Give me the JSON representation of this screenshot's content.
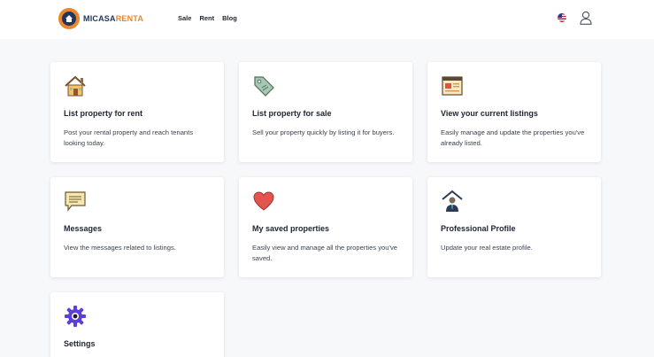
{
  "brand": {
    "part1": "MICASA",
    "part2": "RENTA"
  },
  "nav": {
    "sale": "Sale",
    "rent": "Rent",
    "blog": "Blog"
  },
  "header": {
    "flag_icon": "us-flag-icon",
    "account_icon": "user-icon"
  },
  "cards": [
    {
      "icon": "house-icon",
      "title": "List property for rent",
      "desc": "Post your rental property and reach tenants looking today."
    },
    {
      "icon": "price-tag-icon",
      "title": "List property for sale",
      "desc": "Sell your property quickly by listing it for buyers."
    },
    {
      "icon": "listing-browser-icon",
      "title": "View your current listings",
      "desc": "Easily manage and update the properties you've already listed."
    },
    {
      "icon": "message-icon",
      "title": "Messages",
      "desc": "View the messages related to listings."
    },
    {
      "icon": "heart-icon",
      "title": "My saved properties",
      "desc": "Easily view and manage all the properties you've saved."
    },
    {
      "icon": "agent-profile-icon",
      "title": "Professional Profile",
      "desc": "Update your real estate profile."
    },
    {
      "icon": "gear-icon",
      "title": "Settings",
      "desc": ""
    }
  ],
  "colors": {
    "brand_navy": "#24355c",
    "brand_orange": "#e8872f",
    "heart": "#e2554f",
    "gear": "#5b3fd6"
  }
}
